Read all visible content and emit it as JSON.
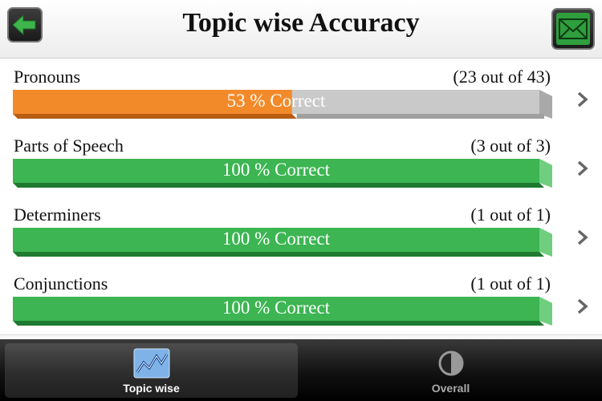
{
  "header": {
    "title": "Topic wise Accuracy",
    "back_icon": "arrow-left-icon",
    "mail_icon": "envelope-icon"
  },
  "topics": [
    {
      "name": "Pronouns",
      "count": "(23 out of 43)",
      "progress": 53,
      "bar_text": "53 % Correct"
    },
    {
      "name": "Parts of Speech",
      "count": "(3 out of 3)",
      "progress": 100,
      "bar_text": "100 % Correct"
    },
    {
      "name": "Determiners",
      "count": "(1 out of 1)",
      "progress": 100,
      "bar_text": "100 % Correct"
    },
    {
      "name": "Conjunctions",
      "count": "(1 out of 1)",
      "progress": 100,
      "bar_text": "100 % Correct"
    }
  ],
  "colors": {
    "partial": "#f38a2a",
    "complete": "#3cb552",
    "empty": "#bdbdbd"
  },
  "tabs": [
    {
      "label": "Topic wise",
      "icon": "line-chart-icon",
      "active": true
    },
    {
      "label": "Overall",
      "icon": "half-circle-icon",
      "active": false
    }
  ]
}
